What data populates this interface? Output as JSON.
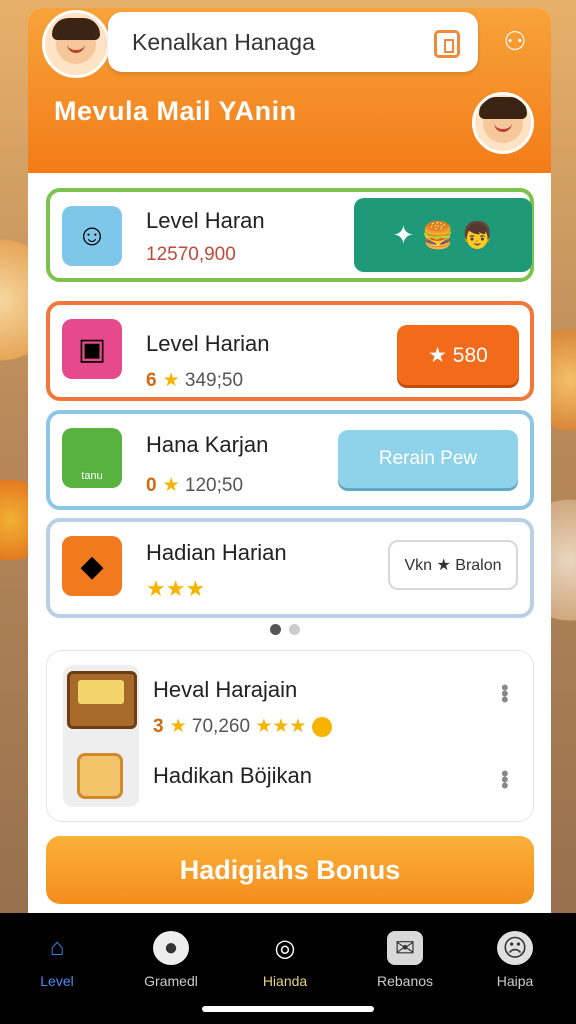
{
  "header": {
    "title": "Kenalkan Hanaga",
    "subtitle": "Mevula Mail YAnin",
    "top_avatar_icon": "girl-avatar-icon",
    "right_avatar_icon": "girl-avatar-icon",
    "copy_icon": "copy-icon",
    "people_icon": "people-icon"
  },
  "cards": [
    {
      "name": "Level Haran",
      "value": "12570,900",
      "action_label": "✦ 🍔 👦"
    },
    {
      "name": "Level Harian",
      "count": "6",
      "value": "349;50",
      "action_label": "★ 580"
    },
    {
      "name": "Hana Karjan",
      "count": "0",
      "value": "120;50",
      "thumb_label": "tanu",
      "action_label": "Rerain Pew"
    },
    {
      "name": "Hadian Harian",
      "stars": "★★★",
      "action_label": "Vkn ★ Bralon"
    }
  ],
  "pager": {
    "pages": 2,
    "active": 0
  },
  "panel": {
    "item1_name": "Heval Harajain",
    "item1_count": "3",
    "item1_value": "70,260",
    "item1_stars": "★★★",
    "item2_name": "Hadikan Böjikan"
  },
  "bonus_button": "Hadigiahs Bonus",
  "nav": {
    "items": [
      {
        "label": "Level",
        "icon": "home-icon"
      },
      {
        "label": "Gramedl",
        "icon": "person-icon"
      },
      {
        "label": "Hianda",
        "icon": "map-icon"
      },
      {
        "label": "Rebanos",
        "icon": "message-icon"
      },
      {
        "label": "Haipa",
        "icon": "help-icon"
      }
    ]
  },
  "colors": {
    "header": "#f37c18",
    "accent_green": "#7cc24c",
    "accent_orange": "#f3763a",
    "nav_active": "#4a8af2"
  }
}
